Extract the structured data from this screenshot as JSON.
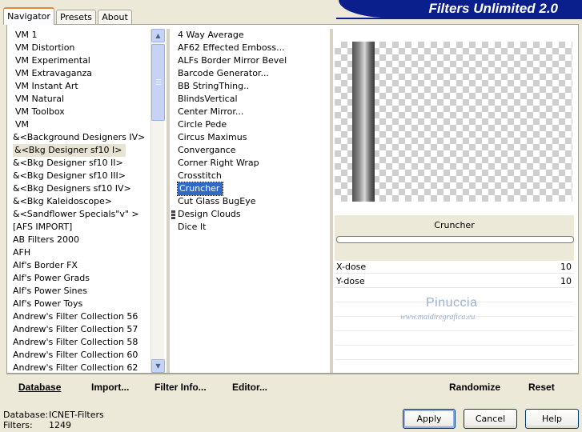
{
  "tabs": [
    "Navigator",
    "Presets",
    "About"
  ],
  "banner_title": "Filters Unlimited 2.0",
  "categories": [
    "VM 1",
    "VM Distortion",
    "VM Experimental",
    "VM Extravaganza",
    "VM Instant Art",
    "VM Natural",
    "VM Toolbox",
    "VM",
    "&<Background Designers IV>",
    "&<Bkg Designer sf10 I>",
    "&<Bkg Designer sf10 II>",
    "&<Bkg Designer sf10 III>",
    "&<Bkg Designers sf10 IV>",
    "&<Bkg Kaleidoscope>",
    "&<Sandflower Specials\"v\" >",
    "[AFS IMPORT]",
    "AB Filters 2000",
    "AFH",
    "Alf's Border FX",
    "Alf's Power Grads",
    "Alf's Power Sines",
    "Alf's Power Toys",
    "Andrew's Filter Collection 56",
    "Andrew's Filter Collection 57",
    "Andrew's Filter Collection 58",
    "Andrew's Filter Collection 60",
    "Andrew's Filter Collection 62"
  ],
  "selected_category": "&<Bkg Designer sf10 I>",
  "filters": [
    "4 Way Average",
    "AF62 Effected Emboss...",
    "ALFs Border Mirror Bevel",
    "Barcode Generator...",
    "BB StringThing..",
    "BlindsVertical",
    "Center Mirror...",
    "Circle Pede",
    "Circus Maximus",
    "Convergance",
    "Corner Right Wrap",
    "Crosstitch",
    "Cruncher",
    "Cut Glass  BugEye",
    "Design Clouds",
    "Dice It"
  ],
  "selected_filter": "Cruncher",
  "preview": {
    "filter_name": "Cruncher",
    "progress": 0
  },
  "params": [
    {
      "label": "X-dose",
      "value": "10"
    },
    {
      "label": "Y-dose",
      "value": "10"
    }
  ],
  "watermark": {
    "line1": "Pinuccia",
    "line2": "www.maidiregrafica.eu"
  },
  "bottom_buttons": {
    "database": "Database",
    "import": "Import...",
    "filter_info": "Filter Info...",
    "editor": "Editor...",
    "randomize": "Randomize",
    "reset": "Reset"
  },
  "status": {
    "database_label": "Database:",
    "database_value": "ICNET-Filters",
    "filters_label": "Filters:",
    "filters_value": "1249"
  },
  "dialog_buttons": {
    "apply": "Apply",
    "cancel": "Cancel",
    "help": "Help"
  },
  "colors": {
    "banner": "#0a1e8c",
    "selection": "#316ac5",
    "tab_accent": "#e68b2c"
  }
}
